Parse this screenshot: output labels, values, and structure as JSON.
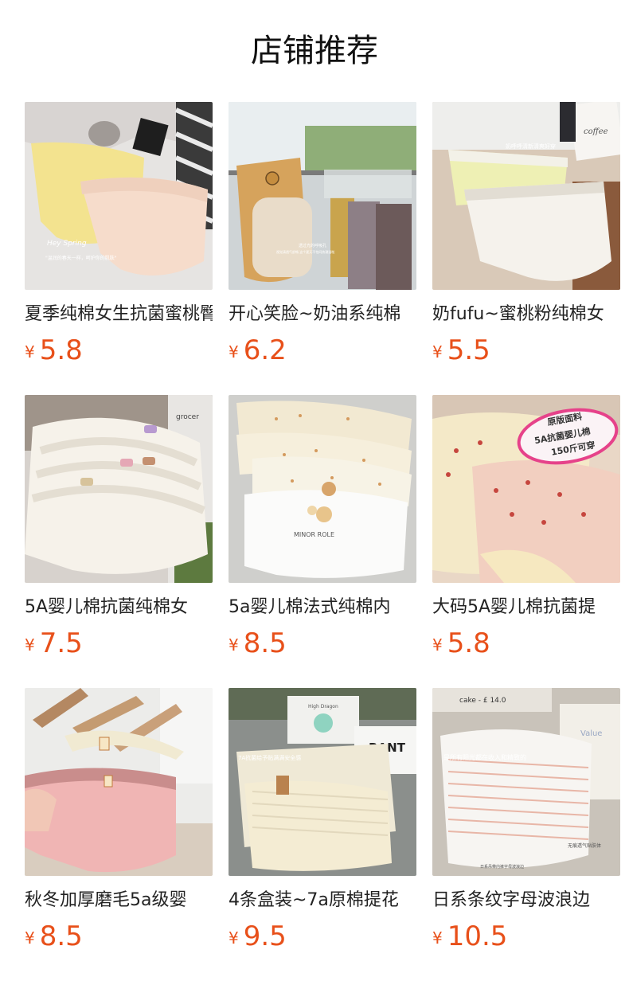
{
  "section": {
    "title": "店铺推荐"
  },
  "currency": "¥",
  "products": [
    {
      "name": "夏季纯棉女生抗菌蜜桃臀",
      "price": "5.8",
      "image_icon": "product-photo-icon",
      "image_texts": [
        "Hey Spring",
        "\"温润的春天一样，呵护你的肌肤\""
      ]
    },
    {
      "name": "开心笑脸~奶油系纯棉",
      "price": "6.2",
      "image_icon": "product-photo-icon",
      "image_texts": [
        "透过光的呼吸孔",
        "视觉清透气舒畅 这个夏天不怕闷热潮湿啦"
      ]
    },
    {
      "name": "奶fufu~蜜桃粉纯棉女",
      "price": "5.5",
      "image_icon": "product-photo-icon",
      "image_texts": [
        "奶呼呼清新清爽好穿",
        "coffee"
      ]
    },
    {
      "name": "5A婴儿棉抗菌纯棉女",
      "price": "7.5",
      "image_icon": "product-photo-icon",
      "image_texts": [
        "grocer"
      ]
    },
    {
      "name": "5a婴儿棉法式纯棉内",
      "price": "8.5",
      "image_icon": "product-photo-icon",
      "image_texts": [
        "MINOR ROLE"
      ]
    },
    {
      "name": "大码5A婴儿棉抗菌提",
      "price": "5.8",
      "image_icon": "product-photo-icon",
      "image_texts": [
        "原版面料",
        "5A抗菌婴儿棉",
        "150斤可穿"
      ]
    },
    {
      "name": "秋冬加厚磨毛5a级婴",
      "price": "8.5",
      "image_icon": "product-photo-icon",
      "image_texts": []
    },
    {
      "name": "4条盒装~7a原棉提花",
      "price": "9.5",
      "image_icon": "product-photo-icon",
      "image_texts": [
        "7A抗菌给予贴满满安全感",
        "RANT",
        "High Dragon"
      ]
    },
    {
      "name": "日系条纹字母波浪边",
      "price": "10.5",
      "image_icon": "product-photo-icon",
      "image_texts": [
        "cake - £ 14.0",
        "是所有阳光都在收入和精致的",
        "Value",
        "无痕透气贴肤体",
        "日系吊带内裤字母波浪边"
      ]
    }
  ],
  "colors": {
    "price": "#e8501a",
    "title": "#111111",
    "text": "#222222",
    "background": "#ffffff"
  }
}
